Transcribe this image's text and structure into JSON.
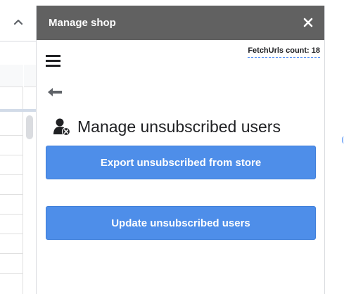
{
  "sidebar_strip": {
    "collapse_icon": "chevron-up-icon"
  },
  "panel": {
    "title": "Manage shop",
    "close_icon": "close-icon",
    "menu_icon": "hamburger-menu-icon",
    "fetch_count_label": "FetchUrls count: 18",
    "back_icon": "arrow-left-icon",
    "section": {
      "icon": "user-remove-icon",
      "title": "Manage unsubscribed users"
    },
    "buttons": {
      "export_label": "Export unsubscribed from store",
      "update_label": "Update unsubscribed users"
    }
  },
  "colors": {
    "header_bg": "#616161",
    "button_bg": "#4e8ee9",
    "dashed_underline": "#4285f4"
  }
}
